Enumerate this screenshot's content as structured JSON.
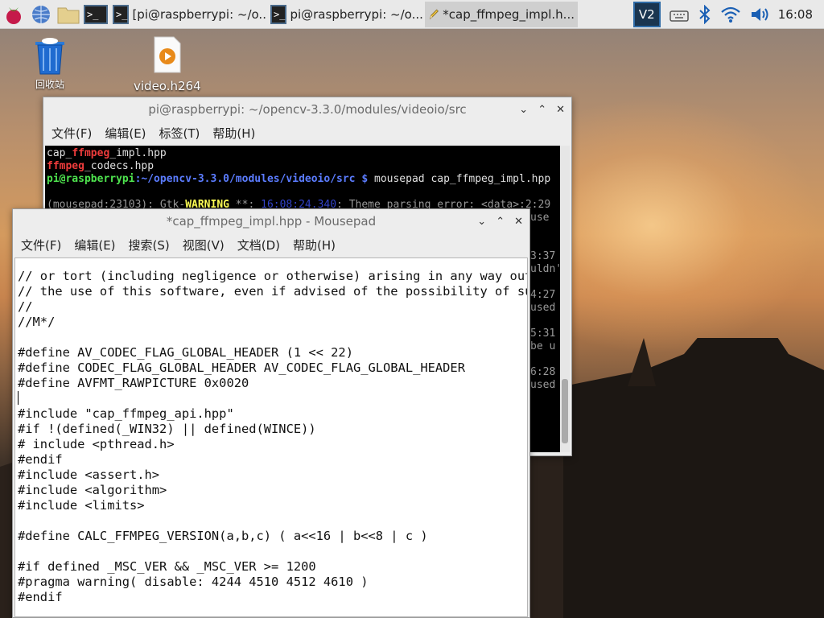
{
  "taskbar": {
    "icons": [
      "raspberry-menu-icon",
      "web-browser-icon",
      "file-manager-icon",
      "terminal-icon"
    ],
    "tasks": [
      {
        "label": "[pi@raspberrypi: ~/o...",
        "icon": "terminal-icon"
      },
      {
        "label": "pi@raspberrypi: ~/o...",
        "icon": "terminal-icon"
      },
      {
        "label": "*cap_ffmpeg_impl.h...",
        "icon": "pencil-icon",
        "active": true
      }
    ],
    "tray": [
      "vnc-icon",
      "keyboard-icon",
      "bluetooth-icon",
      "wifi-icon",
      "volume-icon"
    ],
    "clock": "16:08"
  },
  "desktop": {
    "trash_label": "回收站",
    "video_label": "video.h264"
  },
  "terminal": {
    "title": "pi@raspberrypi: ~/opencv-3.3.0/modules/videoio/src",
    "menu": [
      "文件(F)",
      "编辑(E)",
      "标签(T)",
      "帮助(H)"
    ],
    "lines": {
      "l1_a": "cap_",
      "l1_b": "ffmpeg",
      "l1_c": "_impl.hpp",
      "l2_a": "ffmpeg",
      "l2_b": "_codecs.hpp",
      "prompt_user": "pi@raspberrypi",
      "prompt_path": ":~/opencv-3.3.0/modules/videoio/src $",
      "command": " mousepad cap_ffmpeg_impl.hpp",
      "warn_a": "(mousepad:23103): Gtk-",
      "warn_b": "WARNING",
      "warn_c": " **: ",
      "warn_time": "16:08:24.340",
      "warn_d": ": Theme parsing error: <data>:2:29",
      "r1": "use",
      "r2": "3:37",
      "r3": "uldn'",
      "r4": "4:27",
      "r5": "used",
      "r6": "5:31",
      "r7": "be u",
      "r8": "6:28",
      "r9": "used"
    }
  },
  "mousepad": {
    "title": "*cap_ffmpeg_impl.hpp - Mousepad",
    "menu": [
      "文件(F)",
      "编辑(E)",
      "搜索(S)",
      "视图(V)",
      "文档(D)",
      "帮助(H)"
    ],
    "code": [
      "// or tort (including negligence or otherwise) arising in any way out of",
      "// the use of this software, even if advised of the possibility of such damage.",
      "//",
      "//M*/",
      "",
      "#define AV_CODEC_FLAG_GLOBAL_HEADER (1 << 22)",
      "#define CODEC_FLAG_GLOBAL_HEADER AV_CODEC_FLAG_GLOBAL_HEADER",
      "#define AVFMT_RAWPICTURE 0x0020",
      "",
      "#include \"cap_ffmpeg_api.hpp\"",
      "#if !(defined(_WIN32) || defined(WINCE))",
      "# include <pthread.h>",
      "#endif",
      "#include <assert.h>",
      "#include <algorithm>",
      "#include <limits>",
      "",
      "#define CALC_FFMPEG_VERSION(a,b,c) ( a<<16 | b<<8 | c )",
      "",
      "#if defined _MSC_VER && _MSC_VER >= 1200",
      "#pragma warning( disable: 4244 4510 4512 4610 )",
      "#endif"
    ]
  }
}
